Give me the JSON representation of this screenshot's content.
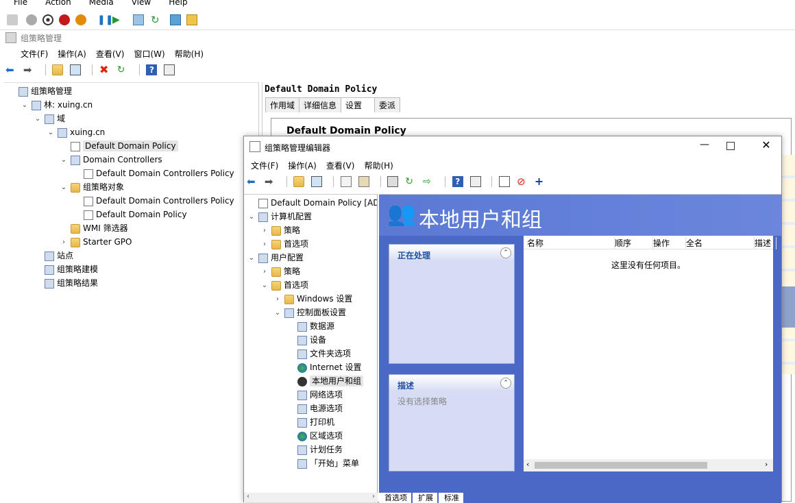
{
  "vm_menu": [
    "File",
    "Action",
    "Media",
    "View",
    "Help"
  ],
  "gpm": {
    "title": "组策略管理",
    "menu": [
      "文件(F)",
      "操作(A)",
      "查看(V)",
      "窗口(W)",
      "帮助(H)"
    ],
    "tree": [
      {
        "label": "组策略管理",
        "indent": 0,
        "chev": "",
        "icon": "gpm-icon"
      },
      {
        "label": "林: xuing.cn",
        "indent": 1,
        "chev": "⌄",
        "icon": "forest-icon"
      },
      {
        "label": "域",
        "indent": 2,
        "chev": "⌄",
        "icon": "domains-icon"
      },
      {
        "label": "xuing.cn",
        "indent": 3,
        "chev": "⌄",
        "icon": "domain-icon"
      },
      {
        "label": "Default Domain Policy",
        "indent": 4,
        "chev": "",
        "icon": "gpo-link-icon",
        "selected": true
      },
      {
        "label": "Domain Controllers",
        "indent": 4,
        "chev": "⌄",
        "icon": "ou-icon"
      },
      {
        "label": "Default Domain Controllers Policy",
        "indent": 5,
        "chev": "",
        "icon": "gpo-link-icon"
      },
      {
        "label": "组策略对象",
        "indent": 4,
        "chev": "⌄",
        "icon": "folder-icon"
      },
      {
        "label": "Default Domain Controllers Policy",
        "indent": 5,
        "chev": "",
        "icon": "gpo-icon"
      },
      {
        "label": "Default Domain Policy",
        "indent": 5,
        "chev": "",
        "icon": "gpo-icon"
      },
      {
        "label": "WMI 筛选器",
        "indent": 4,
        "chev": "",
        "icon": "folder-icon"
      },
      {
        "label": "Starter GPO",
        "indent": 4,
        "chev": "›",
        "icon": "folder-icon"
      },
      {
        "label": "站点",
        "indent": 2,
        "chev": "",
        "icon": "sites-icon"
      },
      {
        "label": "组策略建模",
        "indent": 2,
        "chev": "",
        "icon": "modeling-icon"
      },
      {
        "label": "组策略结果",
        "indent": 2,
        "chev": "",
        "icon": "results-icon"
      }
    ],
    "right_title": "Default Domain Policy",
    "tabs": [
      "作用域",
      "详细信息",
      "设置",
      "委派"
    ],
    "inner_title": "Default Domain Policy"
  },
  "editor": {
    "title": "组策略管理编辑器",
    "menu": [
      "文件(F)",
      "操作(A)",
      "查看(V)",
      "帮助(H)"
    ],
    "tree": [
      {
        "label": "Default Domain Policy [AD.XU",
        "indent": 0,
        "chev": "",
        "icon": "gpo-icon"
      },
      {
        "label": "计算机配置",
        "indent": 0,
        "chev": "⌄",
        "icon": "computer-config-icon"
      },
      {
        "label": "策略",
        "indent": 1,
        "chev": "›",
        "icon": "folder-icon"
      },
      {
        "label": "首选项",
        "indent": 1,
        "chev": "›",
        "icon": "folder-icon"
      },
      {
        "label": "用户配置",
        "indent": 0,
        "chev": "⌄",
        "icon": "user-config-icon"
      },
      {
        "label": "策略",
        "indent": 1,
        "chev": "›",
        "icon": "folder-icon"
      },
      {
        "label": "首选项",
        "indent": 1,
        "chev": "⌄",
        "icon": "folder-icon"
      },
      {
        "label": "Windows 设置",
        "indent": 2,
        "chev": "›",
        "icon": "folder-icon"
      },
      {
        "label": "控制面板设置",
        "indent": 2,
        "chev": "⌄",
        "icon": "control-panel-icon"
      },
      {
        "label": "数据源",
        "indent": 3,
        "chev": "",
        "icon": "data-source-icon"
      },
      {
        "label": "设备",
        "indent": 3,
        "chev": "",
        "icon": "devices-icon"
      },
      {
        "label": "文件夹选项",
        "indent": 3,
        "chev": "",
        "icon": "folder-options-icon"
      },
      {
        "label": "Internet 设置",
        "indent": 3,
        "chev": "",
        "icon": "internet-icon"
      },
      {
        "label": "本地用户和组",
        "indent": 3,
        "chev": "",
        "icon": "local-users-icon",
        "selected": true
      },
      {
        "label": "网络选项",
        "indent": 3,
        "chev": "",
        "icon": "network-icon"
      },
      {
        "label": "电源选项",
        "indent": 3,
        "chev": "",
        "icon": "power-icon"
      },
      {
        "label": "打印机",
        "indent": 3,
        "chev": "",
        "icon": "printer-icon"
      },
      {
        "label": "区域选项",
        "indent": 3,
        "chev": "",
        "icon": "globe-icon"
      },
      {
        "label": "计划任务",
        "indent": 3,
        "chev": "",
        "icon": "task-icon"
      },
      {
        "label": "「开始」菜单",
        "indent": 3,
        "chev": "",
        "icon": "start-menu-icon"
      }
    ],
    "header_title": "本地用户和组",
    "processing_label": "正在处理",
    "description_label": "描述",
    "description_text": "没有选择策略",
    "columns": [
      "名称",
      "顺序",
      "操作",
      "全名",
      "描述"
    ],
    "empty_text": "这里没有任何项目。",
    "bottom_tabs": [
      "首选项",
      "扩展",
      "标准"
    ]
  },
  "colors": {
    "accent": "#4a69c7",
    "panel": "#d6dcf3",
    "header_bg": "#6b86dc"
  }
}
